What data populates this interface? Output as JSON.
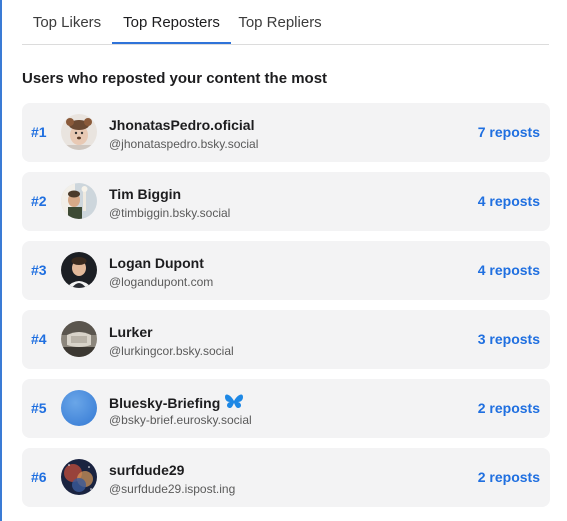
{
  "tabs": [
    {
      "label": "Top Likers"
    },
    {
      "label": "Top Reposters"
    },
    {
      "label": "Top Repliers"
    }
  ],
  "heading": "Users who reposted your content the most",
  "users": [
    {
      "rank": "#1",
      "name": "JhonatasPedro.oficial",
      "handle": "@jhonataspedro.bsky.social",
      "count": "7 reposts"
    },
    {
      "rank": "#2",
      "name": "Tim Biggin",
      "handle": "@timbiggin.bsky.social",
      "count": "4 reposts"
    },
    {
      "rank": "#3",
      "name": "Logan Dupont",
      "handle": "@logandupont.com",
      "count": "4 reposts"
    },
    {
      "rank": "#4",
      "name": "Lurker",
      "handle": "@lurkingcor.bsky.social",
      "count": "3 reposts"
    },
    {
      "rank": "#5",
      "name": "Bluesky-Briefing",
      "handle": "@bsky-brief.eurosky.social",
      "count": "2 reposts",
      "badge": "butterfly-icon"
    },
    {
      "rank": "#6",
      "name": "surfdude29",
      "handle": "@surfdude29.ispost.ing",
      "count": "2 reposts"
    }
  ],
  "colors": {
    "accent": "#1f6fe0",
    "row_bg": "#f3f3f4"
  }
}
